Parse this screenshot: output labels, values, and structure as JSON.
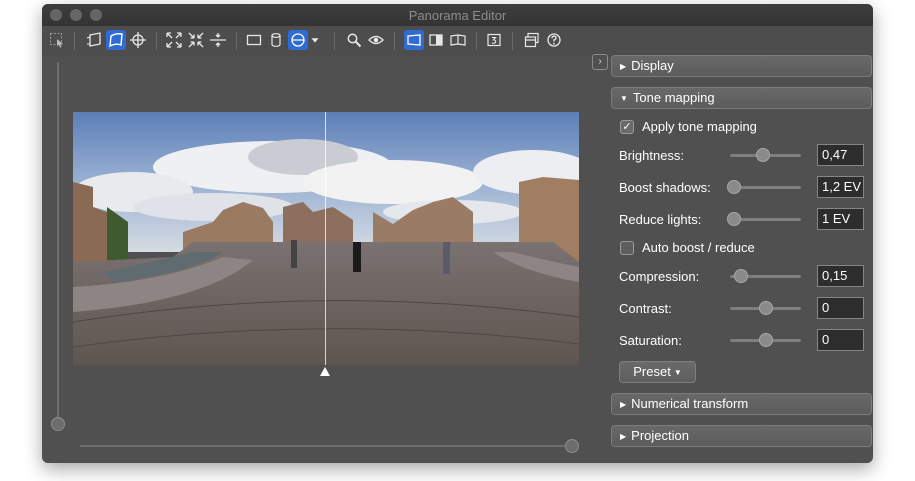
{
  "window": {
    "title": "Panorama Editor"
  },
  "toolbar": {
    "buttons": [
      {
        "icon": "select-arrow-icon",
        "active": false
      },
      {
        "icon": "perspective-frame-icon",
        "active": false
      },
      {
        "icon": "warp-frame-icon",
        "active": true
      },
      {
        "icon": "crosshair-icon",
        "active": false
      },
      {
        "icon": "expand-icon",
        "active": false
      },
      {
        "icon": "collapse-icon",
        "active": false
      },
      {
        "icon": "horizon-icon",
        "active": false
      },
      {
        "icon": "rectangle-icon",
        "active": false
      },
      {
        "icon": "cylinder-icon",
        "active": false
      },
      {
        "icon": "sphere-icon",
        "active": true
      },
      {
        "icon": "dropdown-icon",
        "active": false
      },
      {
        "icon": "zoom-icon",
        "active": false
      },
      {
        "icon": "eye-icon",
        "active": false
      },
      {
        "icon": "view-rect-icon",
        "active": true
      },
      {
        "icon": "view-split-icon",
        "active": false
      },
      {
        "icon": "view-book-icon",
        "active": false
      },
      {
        "icon": "3d-icon",
        "active": false
      },
      {
        "icon": "window-layout-icon",
        "active": false
      },
      {
        "icon": "help-icon",
        "active": false
      }
    ]
  },
  "preview": {
    "vertical_slider": 0.0,
    "horizontal_slider": 1.0
  },
  "panel": {
    "collapse_icon": "chevron-right-icon",
    "sections": {
      "display": "Display",
      "tone_mapping": "Tone mapping",
      "numerical_transform": "Numerical transform",
      "projection": "Projection"
    },
    "tone": {
      "apply_label": "Apply tone mapping",
      "apply_checked": true,
      "brightness_label": "Brightness:",
      "brightness_value": "0,47",
      "brightness_pos": 0.47,
      "boost_shadows_label": "Boost shadows:",
      "boost_shadows_value": "1,2 EV",
      "boost_shadows_pos": 0.06,
      "reduce_lights_label": "Reduce lights:",
      "reduce_lights_value": "1 EV",
      "reduce_lights_pos": 0.05,
      "auto_boost_label": "Auto boost / reduce",
      "auto_boost_checked": false,
      "compression_label": "Compression:",
      "compression_value": "0,15",
      "compression_pos": 0.15,
      "contrast_label": "Contrast:",
      "contrast_value": "0",
      "contrast_pos": 0.5,
      "saturation_label": "Saturation:",
      "saturation_value": "0",
      "saturation_pos": 0.5,
      "preset_label": "Preset"
    }
  }
}
